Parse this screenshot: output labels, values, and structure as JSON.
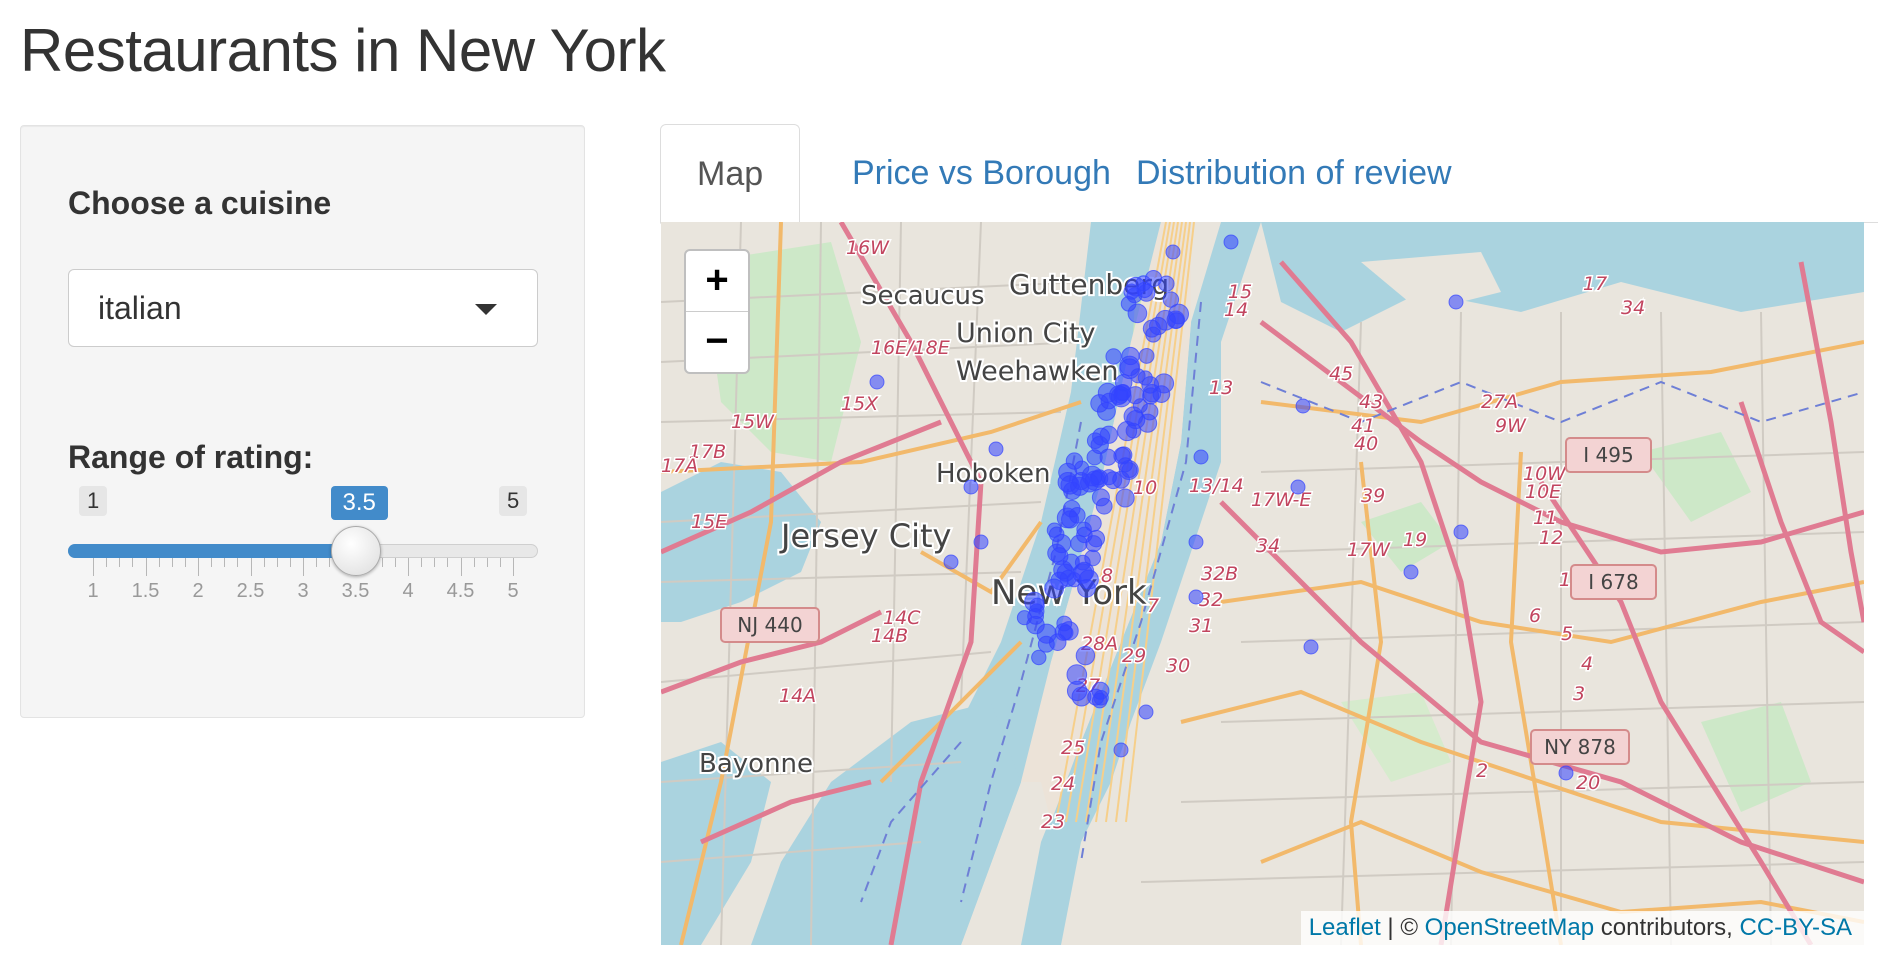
{
  "page": {
    "title": "Restaurants in New York"
  },
  "sidebar": {
    "cuisine_label": "Choose a cuisine",
    "cuisine_value": "italian",
    "rating_label": "Range of rating:",
    "rating_slider": {
      "min": 1,
      "max": 5,
      "value": 3.5,
      "min_label": "1",
      "max_label": "5",
      "value_label": "3.5",
      "tick_labels": [
        "1",
        "1.5",
        "2",
        "2.5",
        "3",
        "3.5",
        "4",
        "4.5",
        "5"
      ]
    }
  },
  "tabs": [
    {
      "label": "Map",
      "active": true
    },
    {
      "label": "Price vs Borough",
      "active": false
    },
    {
      "label": "Distribution of review",
      "active": false
    }
  ],
  "map": {
    "zoom_in": "+",
    "zoom_out": "−",
    "place_labels": [
      "Guttenberg",
      "Secaucus",
      "Union City",
      "Weehawken",
      "Hoboken",
      "Jersey City",
      "New York",
      "Bayonne"
    ],
    "road_labels": [
      "16W",
      "16E/18E",
      "15X",
      "15W",
      "17B",
      "17A",
      "15E",
      "14C",
      "14B",
      "14A",
      "45",
      "43",
      "41",
      "40",
      "39",
      "34",
      "32B",
      "32",
      "31",
      "30",
      "29",
      "28A",
      "27",
      "25",
      "24",
      "23",
      "17W-E",
      "17W",
      "19",
      "13/14",
      "10W",
      "10E",
      "9W",
      "11",
      "12",
      "13W",
      "6",
      "5",
      "4",
      "3",
      "2",
      "20",
      "27A",
      "8",
      "7",
      "10",
      "13",
      "14",
      "15",
      "17",
      "34"
    ],
    "shields": [
      "NJ 440",
      "I 495",
      "I 678",
      "NY 878"
    ],
    "marker_color": "#3344ff",
    "attribution": {
      "leaflet": "Leaflet",
      "sep": " | © ",
      "osm": "OpenStreetMap",
      "contributors": " contributors, ",
      "license": "CC-BY-SA"
    }
  }
}
